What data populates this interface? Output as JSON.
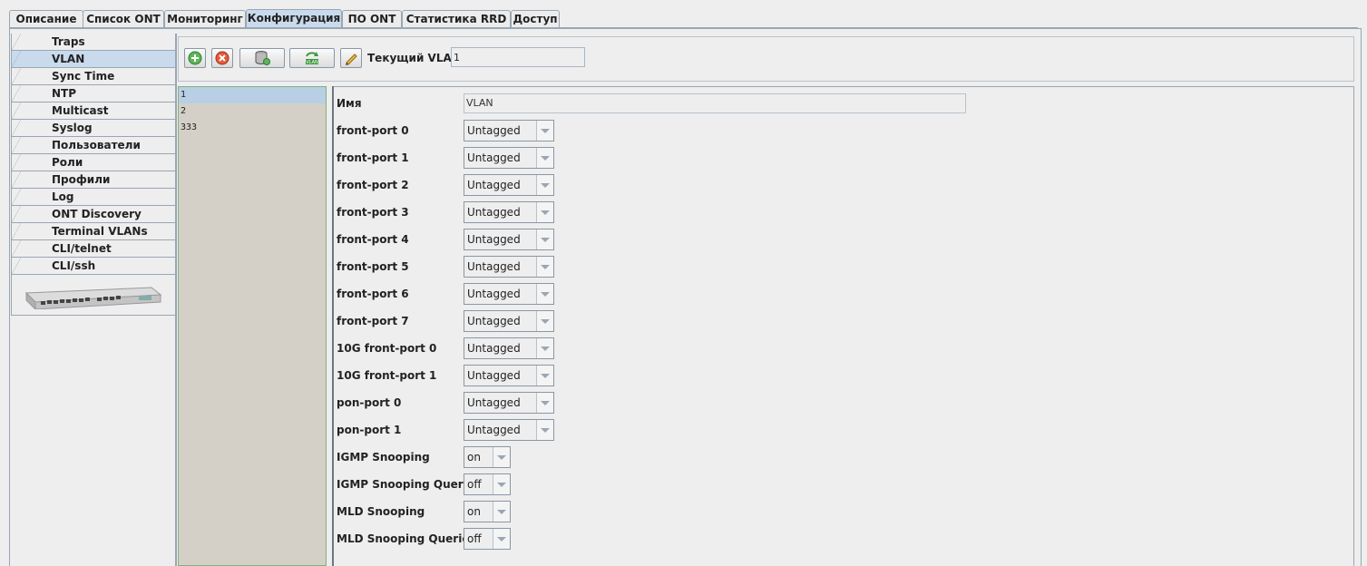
{
  "tabs": [
    {
      "label": "Описание",
      "active": false
    },
    {
      "label": "Список ONT",
      "active": false
    },
    {
      "label": "Мониторинг",
      "active": false
    },
    {
      "label": "Конфигурация",
      "active": true
    },
    {
      "label": "ПО ONT",
      "active": false
    },
    {
      "label": "Статистика RRD",
      "active": false
    },
    {
      "label": "Доступ",
      "active": false
    }
  ],
  "sidebar": {
    "items": [
      {
        "label": "Traps"
      },
      {
        "label": "VLAN",
        "active": true
      },
      {
        "label": "Sync Time"
      },
      {
        "label": "NTP"
      },
      {
        "label": "Multicast"
      },
      {
        "label": "Syslog"
      },
      {
        "label": "Пользователи"
      },
      {
        "label": "Роли"
      },
      {
        "label": "Профили"
      },
      {
        "label": "Log"
      },
      {
        "label": "ONT Discovery"
      },
      {
        "label": "Terminal VLANs"
      },
      {
        "label": "CLI/telnet"
      },
      {
        "label": "CLI/ssh"
      }
    ],
    "device_icon": "olt-device-image"
  },
  "toolbar": {
    "buttons": [
      {
        "icon": "add-icon"
      },
      {
        "icon": "delete-icon"
      },
      {
        "icon": "database-icon"
      },
      {
        "icon": "vlan-refresh-icon"
      },
      {
        "icon": "pencil-icon"
      }
    ],
    "current_vlan_label": "Текущий VLAN:",
    "current_vlan_value": "1"
  },
  "vlan_list": [
    "1",
    "2",
    "333"
  ],
  "selected_vlan_index": 0,
  "form": {
    "name_label": "Имя",
    "name_value": "VLAN",
    "ports": [
      {
        "label": "front-port 0",
        "value": "Untagged"
      },
      {
        "label": "front-port 1",
        "value": "Untagged"
      },
      {
        "label": "front-port 2",
        "value": "Untagged"
      },
      {
        "label": "front-port 3",
        "value": "Untagged"
      },
      {
        "label": "front-port 4",
        "value": "Untagged"
      },
      {
        "label": "front-port 5",
        "value": "Untagged"
      },
      {
        "label": "front-port 6",
        "value": "Untagged"
      },
      {
        "label": "front-port 7",
        "value": "Untagged"
      },
      {
        "label": "10G front-port 0",
        "value": "Untagged"
      },
      {
        "label": "10G front-port 1",
        "value": "Untagged"
      },
      {
        "label": "pon-port 0",
        "value": "Untagged"
      },
      {
        "label": "pon-port 1",
        "value": "Untagged"
      }
    ],
    "flags": [
      {
        "label": "IGMP Snooping",
        "value": "on"
      },
      {
        "label": "IGMP Snooping Querier",
        "value": "off"
      },
      {
        "label": "MLD Snooping",
        "value": "on"
      },
      {
        "label": "MLD Snooping Querier",
        "value": "off"
      }
    ]
  },
  "colors": {
    "active_tab": "#c9daed",
    "border": "#9aa6b3",
    "list_bg": "#d4d0c8",
    "list_selected": "#b8cfe6"
  }
}
